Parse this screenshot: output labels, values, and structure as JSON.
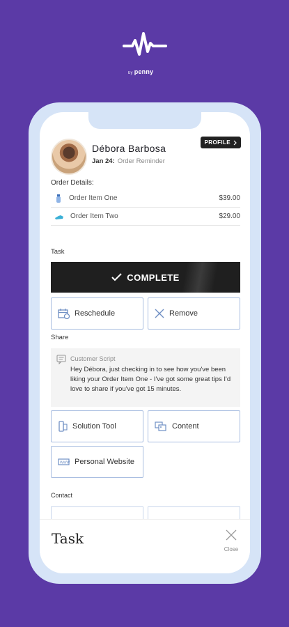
{
  "brand": {
    "by": "by",
    "name": "penny"
  },
  "contact": {
    "name": "Débora Barbosa",
    "date": "Jan 24:",
    "event": "Order Reminder",
    "profile_label": "PROFILE"
  },
  "order": {
    "heading": "Order Details:",
    "items": [
      {
        "name": "Order Item One",
        "price": "$39.00"
      },
      {
        "name": "Order Item Two",
        "price": "$29.00"
      }
    ]
  },
  "task": {
    "heading": "Task",
    "complete_label": "COMPLETE",
    "reschedule_label": "Reschedule",
    "remove_label": "Remove"
  },
  "share": {
    "heading": "Share",
    "script_title": "Customer Script",
    "script_text": "Hey Débora, just checking in to see how you've been liking your Order Item One - I've got some great tips I'd love to share if you've got 15 minutes.",
    "solution_tool_label": "Solution Tool",
    "content_label": "Content",
    "website_label": "Personal Website"
  },
  "contact_section": {
    "heading": "Contact"
  },
  "footer": {
    "title": "Task",
    "close_label": "Close"
  },
  "colors": {
    "background": "#5b3aa6",
    "phone_frame": "#d6e4f7",
    "button_border": "#a8bde0",
    "complete_button": "#1f1f1f"
  }
}
